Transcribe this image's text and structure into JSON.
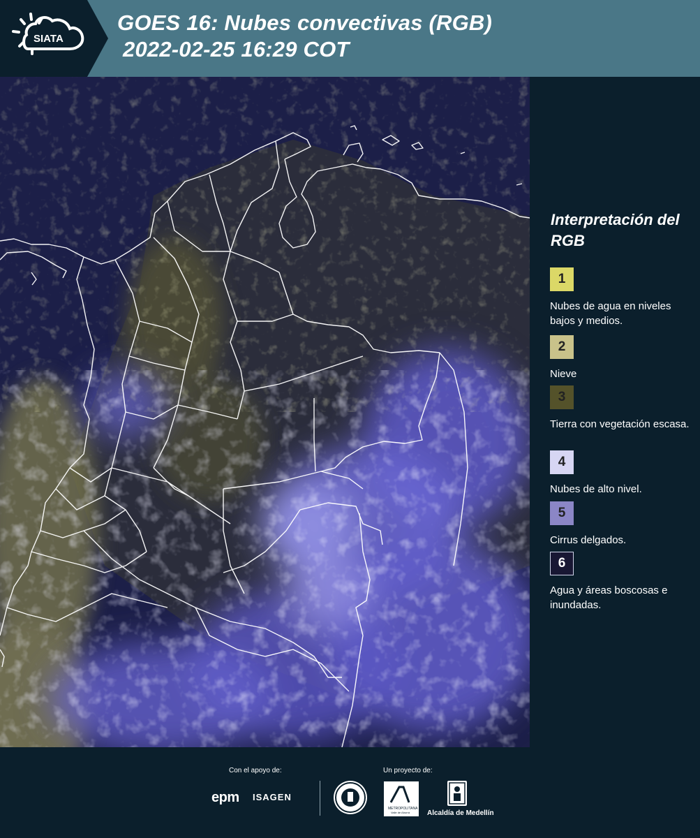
{
  "header": {
    "title_line1": "GOES 16: Nubes convectivas (RGB)",
    "title_line2": "2022-02-25 16:29 COT",
    "logo_text": "SIATA"
  },
  "legend": {
    "title": "Interpretación del RGB",
    "items": [
      {
        "number": "1",
        "color": "#dbd867",
        "text": "Nubes de agua en niveles bajos y medios."
      },
      {
        "number": "2",
        "color": "#c9c28a",
        "text": "Nieve"
      },
      {
        "number": "3",
        "color": "#54522a",
        "text": "Tierra con vegetación escasa."
      },
      {
        "number": "4",
        "color": "#d7d6f3",
        "text": "Nubes de alto nivel."
      },
      {
        "number": "5",
        "color": "#8b86c6",
        "text": "Cirrus delgados."
      },
      {
        "number": "6",
        "color": "#181733",
        "text": "Agua y áreas boscosas e inundadas."
      }
    ]
  },
  "footer": {
    "support_label": "Con el apoyo de:",
    "project_label": "Un proyecto de:",
    "epm": "epm",
    "isagen": "ISAGEN",
    "area_logo_text": "Área METROPOLITANA Valle de Aburrá",
    "alcaldia": "Alcaldía de Medellín"
  }
}
